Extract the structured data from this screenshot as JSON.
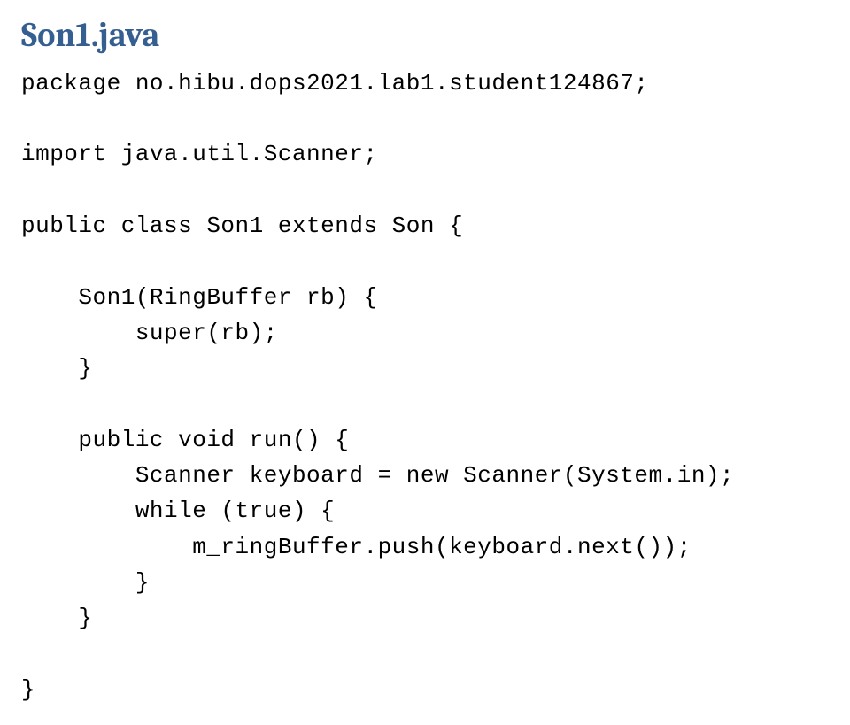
{
  "title": "Son1.java",
  "code": {
    "line1": "package no.hibu.dops2021.lab1.student124867;",
    "line2": "",
    "line3": "import java.util.Scanner;",
    "line4": "",
    "line5": "public class Son1 extends Son {",
    "line6": "",
    "line7": "    Son1(RingBuffer rb) {",
    "line8": "        super(rb);",
    "line9": "    }",
    "line10": "",
    "line11": "    public void run() {",
    "line12": "        Scanner keyboard = new Scanner(System.in);",
    "line13": "        while (true) {",
    "line14": "            m_ringBuffer.push(keyboard.next());",
    "line15": "        }",
    "line16": "    }",
    "line17": "",
    "line18": "}"
  }
}
